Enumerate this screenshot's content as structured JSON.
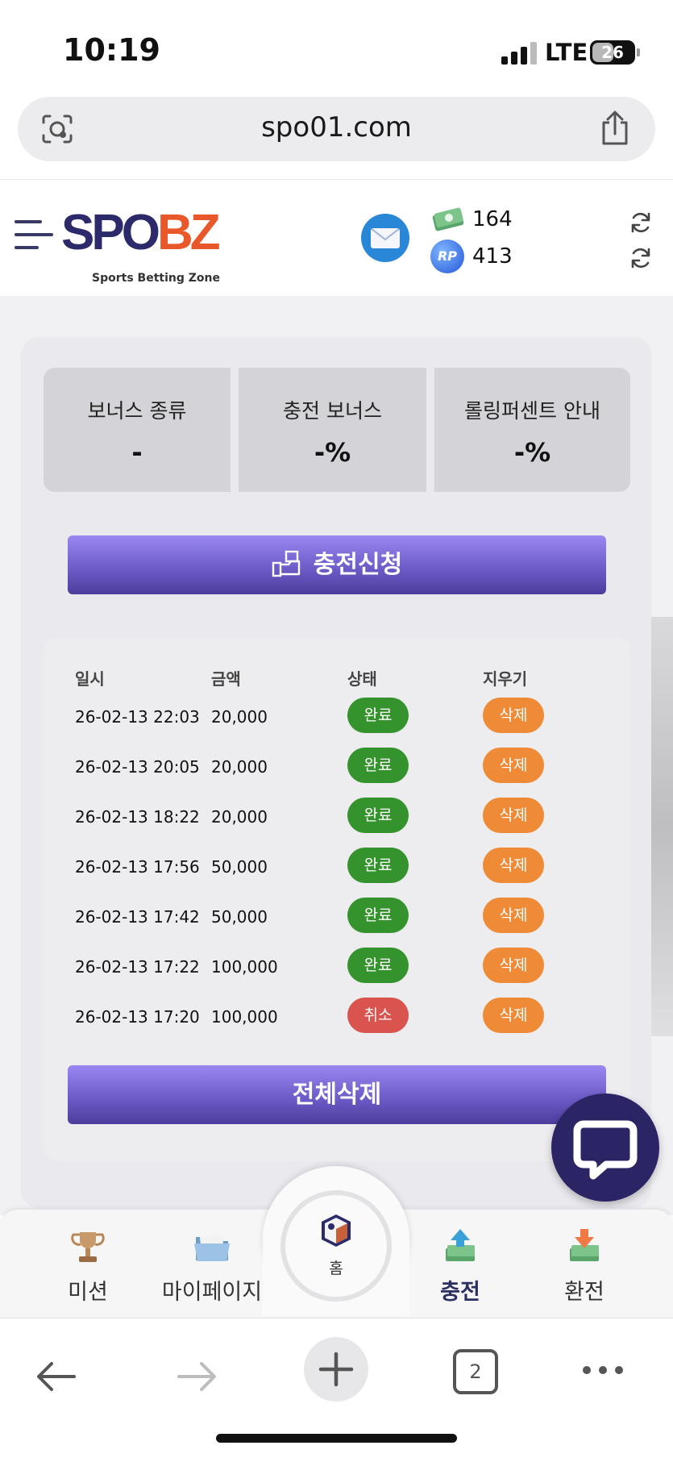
{
  "status_bar": {
    "time": "10:19",
    "network": "LTE",
    "battery": "26"
  },
  "url_bar": {
    "url": "spo01.com"
  },
  "header": {
    "logo_text_a": "SPO",
    "logo_text_b": "BZ",
    "logo_tagline": "Sports Betting Zone",
    "money_value": "164",
    "rp_label": "RP",
    "rp_value": "413"
  },
  "bonus": [
    {
      "label": "보너스 종류",
      "value": "-"
    },
    {
      "label": "충전 보너스",
      "value": "-%"
    },
    {
      "label": "롤링퍼센트 안내",
      "value": "-%"
    }
  ],
  "apply_button": "충전신청",
  "table": {
    "headers": [
      "일시",
      "금액",
      "상태",
      "지우기"
    ],
    "rows": [
      {
        "date": "26-02-13 22:03",
        "amount": "20,000",
        "status": "완료",
        "delete": "삭제"
      },
      {
        "date": "26-02-13 20:05",
        "amount": "20,000",
        "status": "완료",
        "delete": "삭제"
      },
      {
        "date": "26-02-13 18:22",
        "amount": "20,000",
        "status": "완료",
        "delete": "삭제"
      },
      {
        "date": "26-02-13 17:56",
        "amount": "50,000",
        "status": "완료",
        "delete": "삭제"
      },
      {
        "date": "26-02-13 17:42",
        "amount": "50,000",
        "status": "완료",
        "delete": "삭제"
      },
      {
        "date": "26-02-13 17:22",
        "amount": "100,000",
        "status": "완료",
        "delete": "삭제"
      },
      {
        "date": "26-02-13 17:20",
        "amount": "100,000",
        "status": "취소",
        "delete": "삭제"
      }
    ]
  },
  "delete_all_button": "전체삭제",
  "bottom_nav": {
    "mission": "미션",
    "mypage": "마이페이지",
    "home": "홈",
    "charge": "충전",
    "exchange": "환전"
  },
  "browser": {
    "tabs_count": "2"
  },
  "colors": {
    "brand_navy": "#2c2a6b",
    "brand_orange": "#e8582b",
    "status_done": "#35932e",
    "status_cancel": "#d9534f",
    "delete_pill": "#ef8a37",
    "button_purple": "#6e5cc9"
  }
}
